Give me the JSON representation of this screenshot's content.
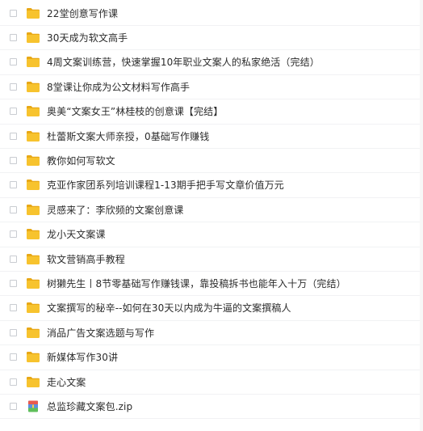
{
  "colors": {
    "folder": "#f7c32e",
    "folder_tab": "#e8a816",
    "text": "#2b2b2b",
    "checkbox_border": "#c9ccd1"
  },
  "files": [
    {
      "name": "22堂创意写作课",
      "icon": "folder-icon"
    },
    {
      "name": "30天成为软文高手",
      "icon": "folder-icon"
    },
    {
      "name": "4周文案训练营，快速掌握10年职业文案人的私家绝活（完结）",
      "icon": "folder-icon"
    },
    {
      "name": "8堂课让你成为公文材料写作高手",
      "icon": "folder-icon"
    },
    {
      "name": "奥美“文案女王”林桂枝的创意课【完结】",
      "icon": "folder-icon"
    },
    {
      "name": "杜蕾斯文案大师亲授，0基础写作赚钱",
      "icon": "folder-icon"
    },
    {
      "name": "教你如何写软文",
      "icon": "folder-icon"
    },
    {
      "name": "克亚作家团系列培训课程1-13期手把手写文章价值万元",
      "icon": "folder-icon"
    },
    {
      "name": "灵感来了：李欣频的文案创意课",
      "icon": "folder-icon"
    },
    {
      "name": "龙小天文案课",
      "icon": "folder-icon"
    },
    {
      "name": "软文营销高手教程",
      "icon": "folder-icon"
    },
    {
      "name": "树獭先生丨8节零基础写作赚钱课，靠投稿拆书也能年入十万（完结）",
      "icon": "folder-icon"
    },
    {
      "name": "文案撰写的秘辛--如何在30天以内成为牛逼的文案撰稿人",
      "icon": "folder-icon"
    },
    {
      "name": "消品广告文案选题与写作",
      "icon": "folder-icon"
    },
    {
      "name": "新媒体写作30讲",
      "icon": "folder-icon"
    },
    {
      "name": "走心文案",
      "icon": "folder-icon"
    },
    {
      "name": "总监珍藏文案包.zip",
      "icon": "zip-archive-icon"
    }
  ]
}
